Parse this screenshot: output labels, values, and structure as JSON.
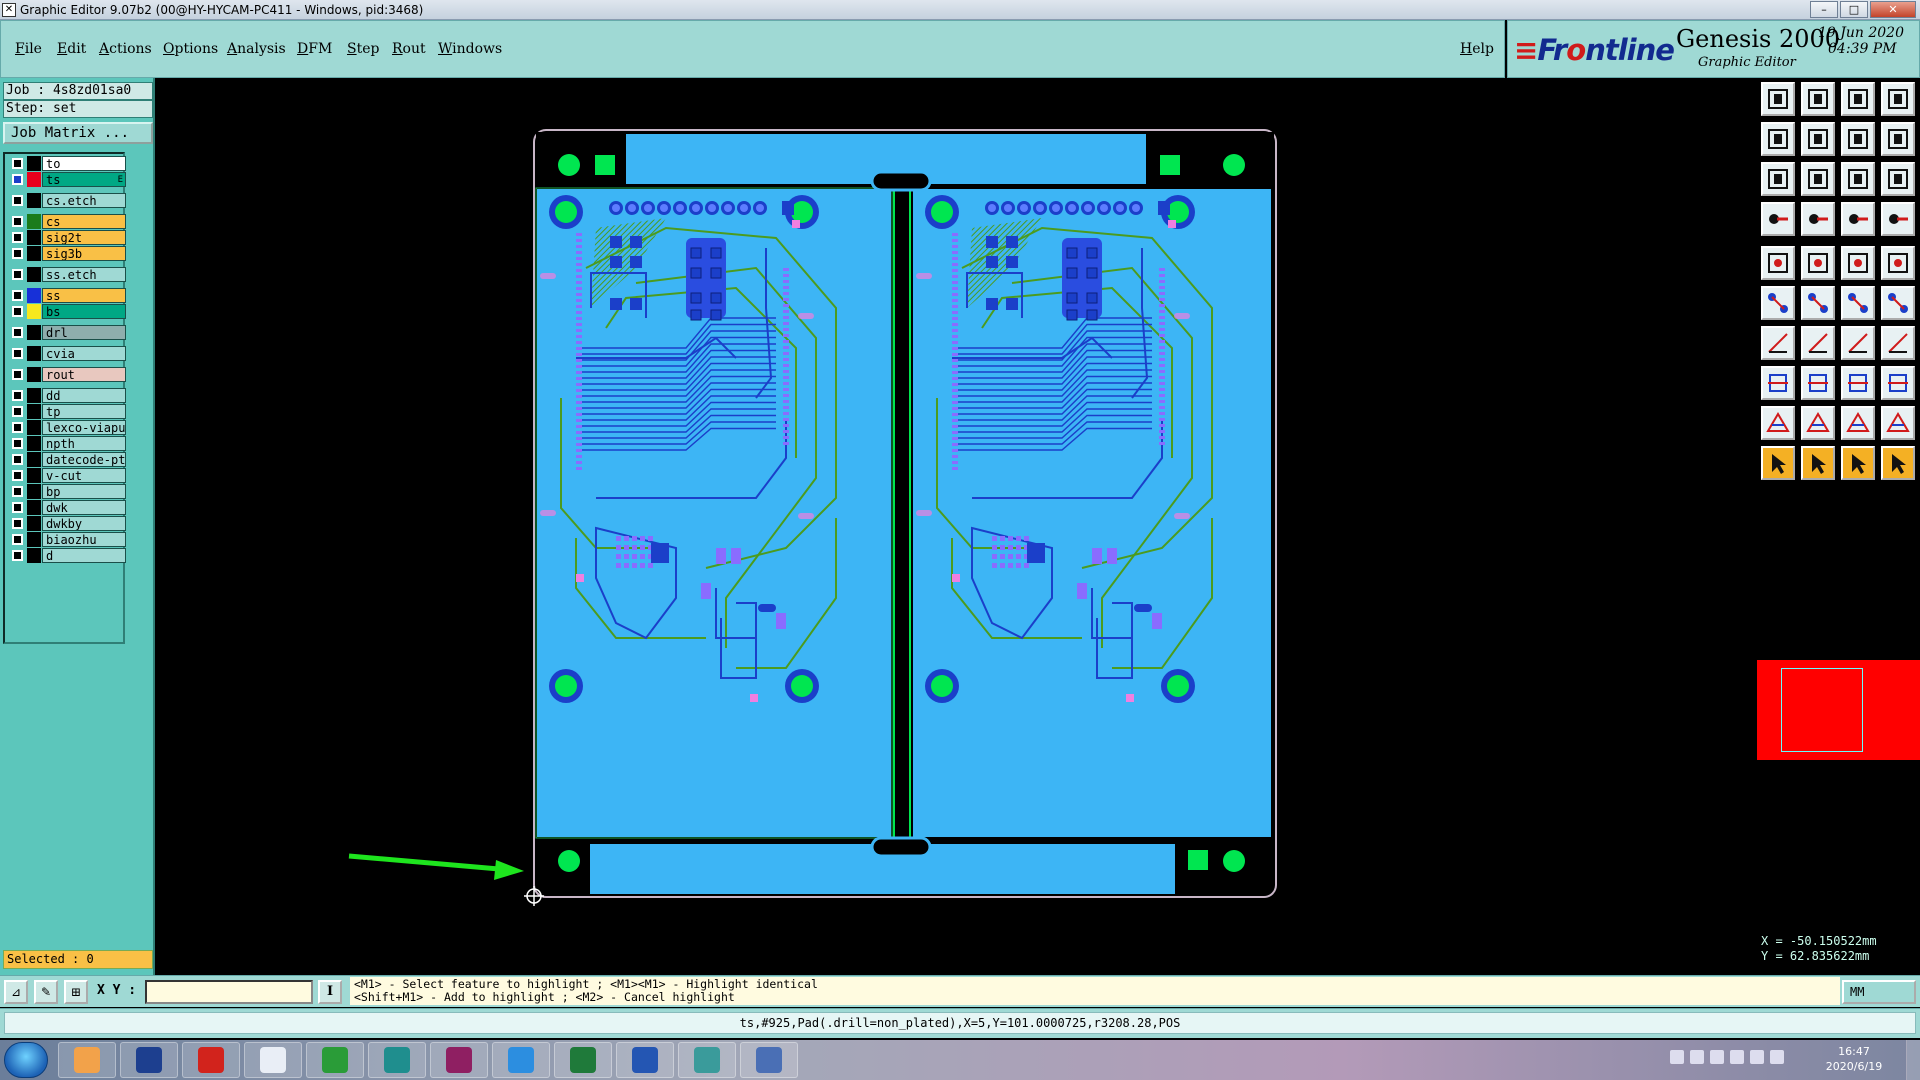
{
  "window": {
    "title": "Graphic Editor 9.07b2 (00@HY-HYCAM-PC411 - Windows, pid:3468)"
  },
  "menu": {
    "items": [
      "File",
      "Edit",
      "Actions",
      "Options",
      "Analysis",
      "DFM",
      "Step",
      "Rout",
      "Windows"
    ],
    "help": "Help"
  },
  "brand": {
    "logo_pre": "Fr",
    "logo_post": "ntline",
    "product": "Genesis 2000",
    "subtitle": "Graphic Editor",
    "date": "19 Jun 2020",
    "time": "04:39 PM"
  },
  "job": {
    "job_label": "Job : 4s8zd01sa0",
    "step_label": "Step: set",
    "matrix_button": "Job Matrix ..."
  },
  "layers": [
    {
      "name": "to",
      "bg": "#ffffff",
      "color": "#000000"
    },
    {
      "name": "ts",
      "bg": "#00a884",
      "color": "#e8001c",
      "marker": "E",
      "selected": true
    },
    {
      "name": "cs.etch",
      "bg": "#9fd9d4",
      "color": "#000000"
    },
    {
      "name": "cs",
      "bg": "#f9c046",
      "color": "#1b7c1b"
    },
    {
      "name": "sig2t",
      "bg": "#f9c046",
      "color": "#000000"
    },
    {
      "name": "sig3b",
      "bg": "#f9c046",
      "color": "#000000"
    },
    {
      "name": "ss.etch",
      "bg": "#9fd9d4",
      "color": "#000000"
    },
    {
      "name": "ss",
      "bg": "#f9c046",
      "color": "#1730d8"
    },
    {
      "name": "bs",
      "bg": "#00a884",
      "color": "#f7e81e"
    },
    {
      "name": "drl",
      "bg": "#8eaead",
      "color": "#000000"
    },
    {
      "name": "cvia",
      "bg": "#9fd9d4",
      "color": "#000000"
    },
    {
      "name": "rout",
      "bg": "#e8c8bf",
      "color": "#000000"
    },
    {
      "name": "dd",
      "bg": "#9fd9d4",
      "color": "#000000"
    },
    {
      "name": "tp",
      "bg": "#9fd9d4",
      "color": "#000000"
    },
    {
      "name": "lexco-viapu",
      "bg": "#9fd9d4",
      "color": "#000000"
    },
    {
      "name": "npth",
      "bg": "#9fd9d4",
      "color": "#000000"
    },
    {
      "name": "datecode-pt",
      "bg": "#9fd9d4",
      "color": "#000000"
    },
    {
      "name": "v-cut",
      "bg": "#9fd9d4",
      "color": "#000000"
    },
    {
      "name": "bp",
      "bg": "#9fd9d4",
      "color": "#000000"
    },
    {
      "name": "dwk",
      "bg": "#9fd9d4",
      "color": "#000000"
    },
    {
      "name": "dwkby",
      "bg": "#9fd9d4",
      "color": "#000000"
    },
    {
      "name": "biaozhu",
      "bg": "#9fd9d4",
      "color": "#000000"
    },
    {
      "name": "d",
      "bg": "#9fd9d4",
      "color": "#000000"
    }
  ],
  "selection": {
    "label": "Selected : 0"
  },
  "coordinates": {
    "x": "X = -50.150522mm",
    "y": "Y = 62.835622mm"
  },
  "prompt": {
    "xy_label": "X Y :",
    "line1": "<M1> - Select feature to highlight ; <M1><M1> - Highlight identical",
    "line2": "<Shift+M1> - Add to highlight ; <M2> - Cancel highlight",
    "units": "MM"
  },
  "status": {
    "feature_info": "ts,#925,Pad(.drill=non_plated),X=5,Y=101.0000725,r3208.28,POS"
  },
  "taskbar": {
    "time": "16:47",
    "date": "2020/6/19"
  },
  "colors": {
    "panel": "#9fd9d4",
    "left_panel": "#5cc6bb",
    "board_fill": "#3db5f5",
    "copper_green": "#00e650",
    "trace_blue": "#1b3fc9",
    "trace_green": "#4c9b1e",
    "pad_violet": "#8a6cff",
    "pad_pink": "#f07fe0",
    "outline": "#c8b6c7",
    "arrow": "#1ee51e",
    "minimap": "#ff0000"
  }
}
